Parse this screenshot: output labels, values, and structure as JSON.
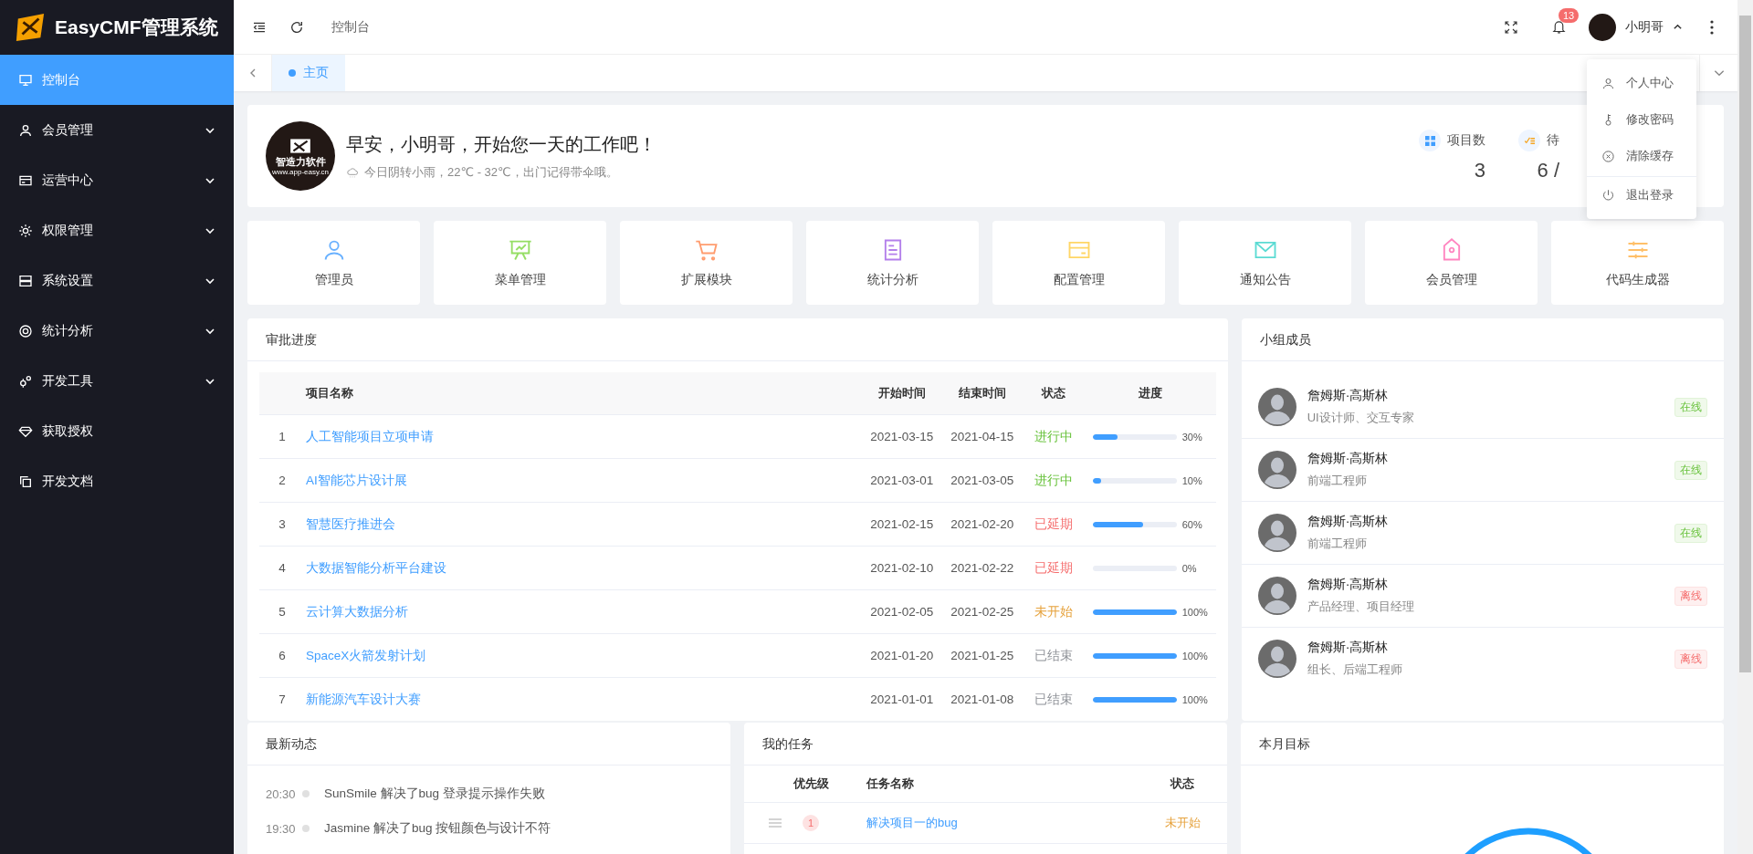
{
  "sidebar": {
    "logo_text": "EasyCMF管理系统",
    "items": [
      {
        "label": "控制台",
        "kind": "link",
        "selected": true
      },
      {
        "label": "会员管理",
        "kind": "group",
        "selected": false
      },
      {
        "label": "运营中心",
        "kind": "group",
        "selected": false
      },
      {
        "label": "权限管理",
        "kind": "group",
        "selected": false
      },
      {
        "label": "系统设置",
        "kind": "group",
        "selected": false
      },
      {
        "label": "统计分析",
        "kind": "group",
        "selected": false
      },
      {
        "label": "开发工具",
        "kind": "group",
        "selected": false
      },
      {
        "label": "获取授权",
        "kind": "link",
        "selected": false
      },
      {
        "label": "开发文档",
        "kind": "link",
        "selected": false
      }
    ]
  },
  "header": {
    "breadcrumb": "控制台",
    "notification_count": "13",
    "user_name": "小明哥"
  },
  "tabs": [
    {
      "label": "主页",
      "selected": true
    }
  ],
  "user_menu": [
    {
      "label": "个人中心",
      "divided": false
    },
    {
      "label": "修改密码",
      "divided": false
    },
    {
      "label": "清除缓存",
      "divided": false
    },
    {
      "label": "退出登录",
      "divided": true
    }
  ],
  "welcome": {
    "greeting": "早安，小明哥，开始您一天的工作吧！",
    "weather": "今日阴转小雨，22℃ - 32℃，出门记得带伞哦。",
    "avatar_title": "智造力软件",
    "avatar_subtitle": "www.app-easy.cn"
  },
  "stats": [
    {
      "label": "项目数",
      "value": "3",
      "color": "#409eff"
    },
    {
      "label": "待",
      "value": "6 /",
      "color": "#f5a623"
    }
  ],
  "shortcuts": [
    {
      "label": "管理员",
      "color": "#69b1ff"
    },
    {
      "label": "菜单管理",
      "color": "#95de64"
    },
    {
      "label": "扩展模块",
      "color": "#ff9c6e"
    },
    {
      "label": "统计分析",
      "color": "#b37feb"
    },
    {
      "label": "配置管理",
      "color": "#ffd666"
    },
    {
      "label": "通知公告",
      "color": "#5cdbd3"
    },
    {
      "label": "会员管理",
      "color": "#ff85c0"
    },
    {
      "label": "代码生成器",
      "color": "#ffc069"
    }
  ],
  "approval": {
    "title": "审批进度",
    "columns": [
      "项目名称",
      "开始时间",
      "结束时间",
      "状态",
      "进度"
    ],
    "rows": [
      {
        "index": "1",
        "name": "人工智能项目立项申请",
        "start": "2021-03-15",
        "end": "2021-04-15",
        "status": "进行中",
        "kind": "running",
        "level": 0.3,
        "percent": "30%"
      },
      {
        "index": "2",
        "name": "AI智能芯片设计展",
        "start": "2021-03-01",
        "end": "2021-03-05",
        "status": "进行中",
        "kind": "running",
        "level": 0.1,
        "percent": "10%"
      },
      {
        "index": "3",
        "name": "智慧医疗推进会",
        "start": "2021-02-15",
        "end": "2021-02-20",
        "status": "已延期",
        "kind": "delayed",
        "level": 0.6,
        "percent": "60%"
      },
      {
        "index": "4",
        "name": "大数据智能分析平台建设",
        "start": "2021-02-10",
        "end": "2021-02-22",
        "status": "已延期",
        "kind": "delayed",
        "level": 0,
        "percent": "0%"
      },
      {
        "index": "5",
        "name": "云计算大数据分析",
        "start": "2021-02-05",
        "end": "2021-02-25",
        "status": "未开始",
        "kind": "pending",
        "level": 1,
        "percent": "100%"
      },
      {
        "index": "6",
        "name": "SpaceX火箭发射计划",
        "start": "2021-01-20",
        "end": "2021-01-25",
        "status": "已结束",
        "kind": "done",
        "level": 1,
        "percent": "100%"
      },
      {
        "index": "7",
        "name": "新能源汽车设计大赛",
        "start": "2021-01-01",
        "end": "2021-01-08",
        "status": "已结束",
        "kind": "done",
        "level": 1,
        "percent": "100%"
      }
    ]
  },
  "members": {
    "title": "小组成员",
    "items": [
      {
        "name": "詹姆斯·高斯林",
        "role": "UI设计师、交互专家",
        "status": "在线",
        "online": true
      },
      {
        "name": "詹姆斯·高斯林",
        "role": "前端工程师",
        "status": "在线",
        "online": true
      },
      {
        "name": "詹姆斯·高斯林",
        "role": "前端工程师",
        "status": "在线",
        "online": true
      },
      {
        "name": "詹姆斯·高斯林",
        "role": "产品经理、项目经理",
        "status": "离线",
        "online": false
      },
      {
        "name": "詹姆斯·高斯林",
        "role": "组长、后端工程师",
        "status": "离线",
        "online": false
      }
    ]
  },
  "activity": {
    "title": "最新动态",
    "items": [
      {
        "time": "20:30",
        "text": "SunSmile 解决了bug 登录提示操作失败"
      },
      {
        "time": "19:30",
        "text": "Jasmine 解决了bug 按钮颜色与设计不符"
      }
    ]
  },
  "tasks": {
    "title": "我的任务",
    "columns": [
      "优先级",
      "任务名称",
      "状态"
    ],
    "rows": [
      {
        "priority": "1",
        "name": "解决项目一的bug",
        "status": "未开始",
        "kind": "pending"
      }
    ]
  },
  "goal": {
    "title": "本月目标"
  }
}
